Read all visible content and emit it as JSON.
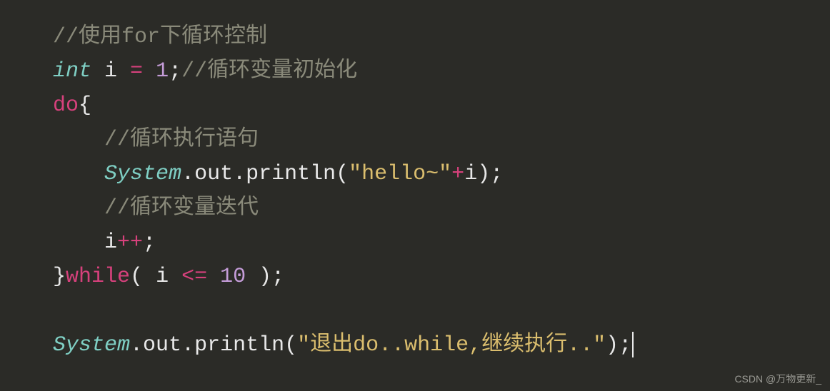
{
  "code": {
    "line1": {
      "comment_prefix": "//",
      "comment_text_a": "使用",
      "for_kw": "for",
      "comment_text_b": "下循环控制"
    },
    "line2": {
      "type": "int",
      "ident": " i ",
      "assign": "=",
      "sp": " ",
      "num": "1",
      "semi": ";",
      "comment": "//循环变量初始化"
    },
    "line3": {
      "do_kw": "do",
      "brace": "{"
    },
    "line4": {
      "indent": "    ",
      "comment": "//循环执行语句"
    },
    "line5": {
      "indent": "    ",
      "class": "System",
      "dot1": ".",
      "out": "out",
      "dot2": ".",
      "println": "println",
      "lparen": "(",
      "str": "\"hello~\"",
      "plus": "+",
      "i": "i",
      "rparen": ")",
      "semi": ";"
    },
    "line6": {
      "indent": "    ",
      "comment": "//循环变量迭代"
    },
    "line7": {
      "indent": "    ",
      "i": "i",
      "inc": "++",
      "semi": ";"
    },
    "line8": {
      "brace": "}",
      "while_kw": "while",
      "lparen": "(",
      "sp1": " ",
      "i": "i ",
      "op": "<=",
      "sp2": " ",
      "num": "10",
      "sp3": " ",
      "rparen": ")",
      "semi": ";"
    },
    "line9": {
      "blank": ""
    },
    "line10": {
      "class": "System",
      "dot1": ".",
      "out": "out",
      "dot2": ".",
      "println": "println",
      "lparen": "(",
      "str": "\"退出do..while,继续执行..\"",
      "rparen": ")",
      "semi": ";"
    }
  },
  "watermark": "CSDN @万物更新_"
}
